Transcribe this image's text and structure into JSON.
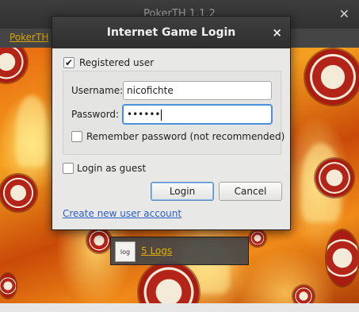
{
  "main_window": {
    "title": "PokerTH 1.1.2",
    "close_glyph": "✕",
    "menu": {
      "poker_label": "PokerTH"
    }
  },
  "logs": {
    "icon_text": "log",
    "label": "5 Logs"
  },
  "dialog": {
    "title": "Internet Game Login",
    "close_glyph": "×",
    "registered_user": {
      "label": "Registered user",
      "checked": true,
      "check_glyph": "✔"
    },
    "username": {
      "label": "Username:",
      "value": "nicofichte"
    },
    "password": {
      "label": "Password:",
      "value": "••••••"
    },
    "remember_password": {
      "label": "Remember password (not recommended)",
      "checked": false
    },
    "login_as_guest": {
      "label": "Login as guest",
      "checked": false
    },
    "buttons": {
      "login": "Login",
      "cancel": "Cancel"
    },
    "create_account_link": "Create new user account"
  },
  "colors": {
    "accent": "#4a90d9",
    "link": "#2a5ec9",
    "menu_text": "#d6a300"
  },
  "icons": [
    "close-icon",
    "checkmark-icon",
    "log-file-icon"
  ]
}
